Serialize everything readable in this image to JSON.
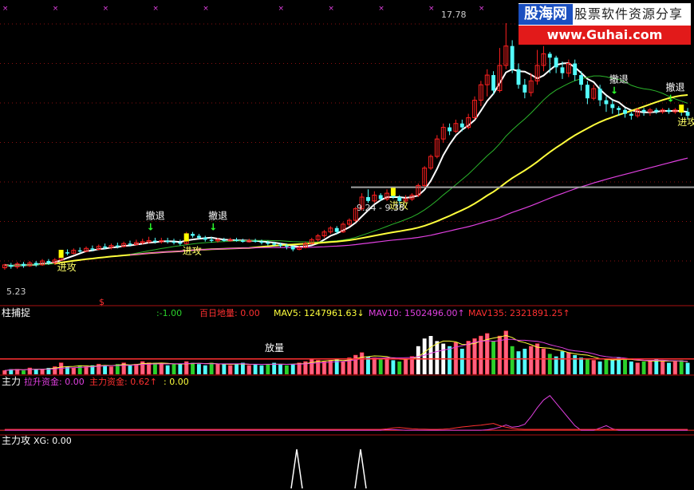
{
  "watermark": {
    "badge": "股海网",
    "tagline": "股票软件资源分享",
    "url": "www.Guhai.com"
  },
  "colors": {
    "up": "#ff2020",
    "down": "#54ffff",
    "ma_white": "#ffffff",
    "ma_green": "#2bb52b",
    "ma_yellow": "#ffff3c",
    "ma_magenta": "#e040e0",
    "separator": "#aa1010",
    "gray_line": "#a0a0a0"
  },
  "chart_data": [
    {
      "type": "candlestick",
      "panel": "main",
      "title": "",
      "annotations": {
        "high_label": "17.78",
        "low_label": "5.23",
        "range_label": "9.24 - 9.38",
        "retreat": "撤退",
        "attack": "进攻",
        "dollar": "$"
      },
      "signals": [
        {
          "bar": 9,
          "kind": "attack"
        },
        {
          "bar": 29,
          "kind": "attack"
        },
        {
          "bar": 62,
          "kind": "attack"
        },
        {
          "bar": 108,
          "kind": "attack"
        },
        {
          "bar": 23,
          "kind": "retreat"
        },
        {
          "bar": 33,
          "kind": "retreat"
        },
        {
          "bar": 97,
          "kind": "retreat"
        },
        {
          "bar": 106,
          "kind": "retreat"
        }
      ],
      "y_range": [
        3.4,
        18.4
      ],
      "horizontal_level": 9.31,
      "candles": [
        [
          5.15,
          5.3,
          5.05,
          5.35
        ],
        [
          5.3,
          5.2,
          5.1,
          5.4
        ],
        [
          5.2,
          5.35,
          5.1,
          5.45
        ],
        [
          5.35,
          5.25,
          5.15,
          5.45
        ],
        [
          5.25,
          5.4,
          5.2,
          5.5
        ],
        [
          5.4,
          5.3,
          5.2,
          5.5
        ],
        [
          5.3,
          5.5,
          5.25,
          5.6
        ],
        [
          5.5,
          5.4,
          5.3,
          5.6
        ],
        [
          5.4,
          5.55,
          5.3,
          5.65
        ],
        [
          5.55,
          5.95,
          5.5,
          6.05
        ],
        [
          5.95,
          5.9,
          5.8,
          6.1
        ],
        [
          5.9,
          6.05,
          5.85,
          6.15
        ],
        [
          6.05,
          6.0,
          5.9,
          6.2
        ],
        [
          6.0,
          6.15,
          5.95,
          6.25
        ],
        [
          6.15,
          6.1,
          6.0,
          6.3
        ],
        [
          6.1,
          6.25,
          6.05,
          6.35
        ],
        [
          6.25,
          6.2,
          6.1,
          6.4
        ],
        [
          6.2,
          6.3,
          6.1,
          6.4
        ],
        [
          6.3,
          6.25,
          6.15,
          6.45
        ],
        [
          6.25,
          6.4,
          6.2,
          6.5
        ],
        [
          6.4,
          6.35,
          6.25,
          6.55
        ],
        [
          6.35,
          6.45,
          6.3,
          6.6
        ],
        [
          6.45,
          6.5,
          6.35,
          6.65
        ],
        [
          6.5,
          6.55,
          6.4,
          6.75
        ],
        [
          6.55,
          6.5,
          6.4,
          6.7
        ],
        [
          6.5,
          6.55,
          6.4,
          6.7
        ],
        [
          6.55,
          6.5,
          6.4,
          6.7
        ],
        [
          6.5,
          6.45,
          6.35,
          6.65
        ],
        [
          6.45,
          6.4,
          6.3,
          6.6
        ],
        [
          6.4,
          6.9,
          6.35,
          7.0
        ],
        [
          6.9,
          6.8,
          6.7,
          7.0
        ],
        [
          6.8,
          6.7,
          6.6,
          6.9
        ],
        [
          6.7,
          6.6,
          6.5,
          6.8
        ],
        [
          6.6,
          6.55,
          6.45,
          6.75
        ],
        [
          6.55,
          6.6,
          6.45,
          6.7
        ],
        [
          6.6,
          6.55,
          6.5,
          6.7
        ],
        [
          6.55,
          6.6,
          6.5,
          6.7
        ],
        [
          6.6,
          6.55,
          6.5,
          6.7
        ],
        [
          6.55,
          6.5,
          6.45,
          6.65
        ],
        [
          6.5,
          6.55,
          6.45,
          6.65
        ],
        [
          6.55,
          6.5,
          6.45,
          6.65
        ],
        [
          6.5,
          6.45,
          6.35,
          6.6
        ],
        [
          6.45,
          6.4,
          6.3,
          6.55
        ],
        [
          6.4,
          6.35,
          6.25,
          6.5
        ],
        [
          6.35,
          6.3,
          6.2,
          6.45
        ],
        [
          6.3,
          6.25,
          6.1,
          6.4
        ],
        [
          6.25,
          6.1,
          6.0,
          6.3
        ],
        [
          6.1,
          6.2,
          6.05,
          6.3
        ],
        [
          6.2,
          6.4,
          6.15,
          6.5
        ],
        [
          6.4,
          6.6,
          6.35,
          6.7
        ],
        [
          6.6,
          6.8,
          6.5,
          6.9
        ],
        [
          6.8,
          7.0,
          6.7,
          7.1
        ],
        [
          7.0,
          7.2,
          6.9,
          7.3
        ],
        [
          7.2,
          7.0,
          6.9,
          7.3
        ],
        [
          7.0,
          7.4,
          6.95,
          7.5
        ],
        [
          7.4,
          7.6,
          7.3,
          7.7
        ],
        [
          7.6,
          8.2,
          7.5,
          8.3
        ],
        [
          8.2,
          8.8,
          8.1,
          9.0
        ],
        [
          8.8,
          8.6,
          8.5,
          9.2
        ],
        [
          8.6,
          8.9,
          8.5,
          9.1
        ],
        [
          8.9,
          8.7,
          8.6,
          9.0
        ],
        [
          8.7,
          9.0,
          8.6,
          9.2
        ],
        [
          9.0,
          8.8,
          8.7,
          9.1
        ],
        [
          8.8,
          8.6,
          8.4,
          8.9
        ],
        [
          8.6,
          8.7,
          8.5,
          8.9
        ],
        [
          8.7,
          8.9,
          8.6,
          9.0
        ],
        [
          8.9,
          9.4,
          8.8,
          9.5
        ],
        [
          9.4,
          10.3,
          9.3,
          10.4
        ],
        [
          10.3,
          10.9,
          10.2,
          11.0
        ],
        [
          10.9,
          11.8,
          10.8,
          12.0
        ],
        [
          11.8,
          12.4,
          11.6,
          12.6
        ],
        [
          12.4,
          12.2,
          12.0,
          12.6
        ],
        [
          12.2,
          12.6,
          12.1,
          12.8
        ],
        [
          12.6,
          12.4,
          12.2,
          12.8
        ],
        [
          12.4,
          12.9,
          12.3,
          13.1
        ],
        [
          12.9,
          13.8,
          12.8,
          14.0
        ],
        [
          13.8,
          14.6,
          13.5,
          14.8
        ],
        [
          14.6,
          15.1,
          14.0,
          15.4
        ],
        [
          15.1,
          14.3,
          14.1,
          15.3
        ],
        [
          14.3,
          15.6,
          14.2,
          16.5
        ],
        [
          15.6,
          16.6,
          15.4,
          17.78
        ],
        [
          16.6,
          15.4,
          15.2,
          16.9
        ],
        [
          15.4,
          14.6,
          14.4,
          15.7
        ],
        [
          14.6,
          14.2,
          13.9,
          14.9
        ],
        [
          14.2,
          14.8,
          14.0,
          15.2
        ],
        [
          14.8,
          15.6,
          14.6,
          16.4
        ],
        [
          15.6,
          16.2,
          15.3,
          16.6
        ],
        [
          16.2,
          16.0,
          15.2,
          16.3
        ],
        [
          16.0,
          15.5,
          15.2,
          16.1
        ],
        [
          15.5,
          15.2,
          14.9,
          15.8
        ],
        [
          15.2,
          15.7,
          15.0,
          15.9
        ],
        [
          15.7,
          15.1,
          14.8,
          15.9
        ],
        [
          15.1,
          14.6,
          14.3,
          15.3
        ],
        [
          14.6,
          13.9,
          13.6,
          14.8
        ],
        [
          13.9,
          14.4,
          13.8,
          14.6
        ],
        [
          14.4,
          13.8,
          13.5,
          14.6
        ],
        [
          13.8,
          13.6,
          13.2,
          14.0
        ],
        [
          13.6,
          13.4,
          13.1,
          13.8
        ],
        [
          13.4,
          13.3,
          13.0,
          13.5
        ],
        [
          13.3,
          13.1,
          12.9,
          13.4
        ],
        [
          13.1,
          13.0,
          12.8,
          13.2
        ],
        [
          13.0,
          13.3,
          12.9,
          13.4
        ],
        [
          13.3,
          13.2,
          13.0,
          13.4
        ],
        [
          13.2,
          13.3,
          13.0,
          13.4
        ],
        [
          13.3,
          13.2,
          13.1,
          13.4
        ],
        [
          13.2,
          13.3,
          13.1,
          13.4
        ],
        [
          13.3,
          13.2,
          13.1,
          13.4
        ],
        [
          13.2,
          13.3,
          13.1,
          13.4
        ],
        [
          13.3,
          13.2,
          13.0,
          13.5
        ],
        [
          13.2,
          13.0,
          12.8,
          13.4
        ]
      ],
      "xg_bars": [
        108,
        113
      ]
    },
    {
      "type": "bar",
      "panel": "volume",
      "title": "柱捕捉",
      "legend": [
        {
          "text": ":-1.00",
          "color": "#2bd12b"
        },
        {
          "text": "百日地量: 0.00",
          "color": "#ff3030"
        },
        {
          "text": "MAV5: 1247961.63↓",
          "color": "#ffff3c"
        },
        {
          "text": "MAV10: 1502496.00↑",
          "color": "#e040e0"
        },
        {
          "text": "MAV135: 2321891.25↑",
          "color": "#ff3030"
        }
      ],
      "label_fangliang": "放量",
      "values": [
        3,
        4,
        4,
        3,
        5,
        4,
        4,
        5,
        6,
        9,
        6,
        5,
        7,
        6,
        7,
        8,
        7,
        6,
        8,
        9,
        7,
        8,
        10,
        9,
        9,
        8,
        7,
        8,
        8,
        10,
        9,
        8,
        7,
        9,
        8,
        8,
        7,
        8,
        9,
        7,
        8,
        7,
        8,
        9,
        8,
        7,
        8,
        9,
        10,
        12,
        11,
        10,
        11,
        12,
        10,
        13,
        15,
        17,
        14,
        13,
        12,
        13,
        11,
        10,
        12,
        14,
        22,
        28,
        30,
        26,
        24,
        22,
        25,
        20,
        26,
        28,
        30,
        32,
        26,
        30,
        34,
        22,
        18,
        20,
        22,
        24,
        20,
        16,
        14,
        18,
        17,
        15,
        13,
        12,
        11,
        10,
        12,
        11,
        13,
        12,
        10,
        9,
        10,
        11,
        12,
        10,
        9,
        10,
        11,
        9,
        10,
        8,
        9,
        10,
        9,
        8,
        9,
        8,
        9,
        8,
        9,
        8,
        9,
        8,
        10,
        9,
        8,
        9,
        10,
        9
      ],
      "ylim": [
        0,
        40
      ]
    },
    {
      "type": "line",
      "panel": "mainforce",
      "title": "主力",
      "legend": [
        {
          "text": "拉升资金: 0.00",
          "color": "#e040e0"
        },
        {
          "text": "主力资金: 0.62↑",
          "color": "#ff3030"
        },
        {
          "text": ": 0.00",
          "color": "#ffff3c"
        }
      ],
      "series": [
        {
          "color": "#e040e0",
          "values": [
            0,
            0,
            0,
            0,
            0,
            0,
            0,
            0,
            0,
            0,
            0,
            0,
            0,
            0,
            0,
            0,
            0,
            0,
            0,
            0,
            0,
            0,
            0,
            0,
            0,
            0,
            0,
            0,
            0,
            0,
            0,
            0,
            0,
            0,
            0,
            0,
            0,
            0,
            0,
            0,
            0,
            0,
            0,
            0,
            0,
            0,
            0,
            0,
            0,
            0,
            0,
            0,
            0,
            0,
            0,
            0,
            0,
            0,
            0,
            0,
            0,
            0.5,
            0.4,
            0.2,
            0,
            0,
            0,
            0,
            0,
            0,
            0,
            0,
            0,
            0,
            0,
            0,
            0,
            0.3,
            1,
            2,
            3.5,
            2,
            2.5,
            4,
            9,
            15,
            20,
            23,
            18,
            13,
            8,
            3,
            0,
            0,
            0,
            1.5,
            3,
            1,
            0,
            0,
            0,
            0,
            0,
            0,
            0,
            0,
            0,
            0,
            0,
            0,
            0,
            0,
            0,
            0,
            0,
            0,
            0,
            0,
            0
          ]
        },
        {
          "color": "#ff3030",
          "values": [
            0.6,
            0.6,
            0.6,
            0.6,
            0.6,
            0.6,
            0.6,
            0.6,
            0.6,
            0.6,
            0.6,
            0.6,
            0.6,
            0.6,
            0.6,
            0.6,
            0.6,
            0.6,
            0.6,
            0.6,
            0.6,
            0.6,
            0.6,
            0.6,
            0.6,
            0.6,
            0.6,
            0.6,
            0.6,
            0.6,
            0.6,
            0.6,
            0.6,
            0.6,
            0.6,
            0.6,
            0.6,
            0.6,
            0.6,
            0.6,
            0.6,
            0.6,
            0.6,
            0.6,
            0.6,
            0.6,
            0.6,
            0.6,
            0.6,
            0.6,
            0.6,
            0.6,
            0.6,
            0.6,
            0.6,
            0.6,
            0.6,
            0.6,
            0.6,
            0.6,
            0.6,
            0.9,
            1.5,
            1.8,
            1.4,
            1,
            0.8,
            0.7,
            0.6,
            0.6,
            0.7,
            1,
            1.6,
            2.2,
            2.6,
            3,
            3.4,
            4,
            4.5,
            3,
            2,
            1.2,
            0.8,
            0.6,
            0.6,
            0.6,
            0.6,
            0.6,
            0.6,
            0.6,
            0.6,
            0.6,
            0.6,
            0.6,
            0.6,
            0.6,
            0.6,
            0.6,
            0.6,
            0.6,
            0.6,
            0.6,
            0.6,
            0.6,
            0.6,
            0.6,
            0.6,
            0.6,
            0.6,
            0.6,
            0.6,
            0.6,
            0.62
          ]
        }
      ],
      "ylim": [
        -1,
        26
      ]
    },
    {
      "type": "line",
      "panel": "attack",
      "title": "主力攻",
      "legend": [
        {
          "text": "XG: 0.00",
          "color": "#ffffff"
        }
      ]
    }
  ]
}
